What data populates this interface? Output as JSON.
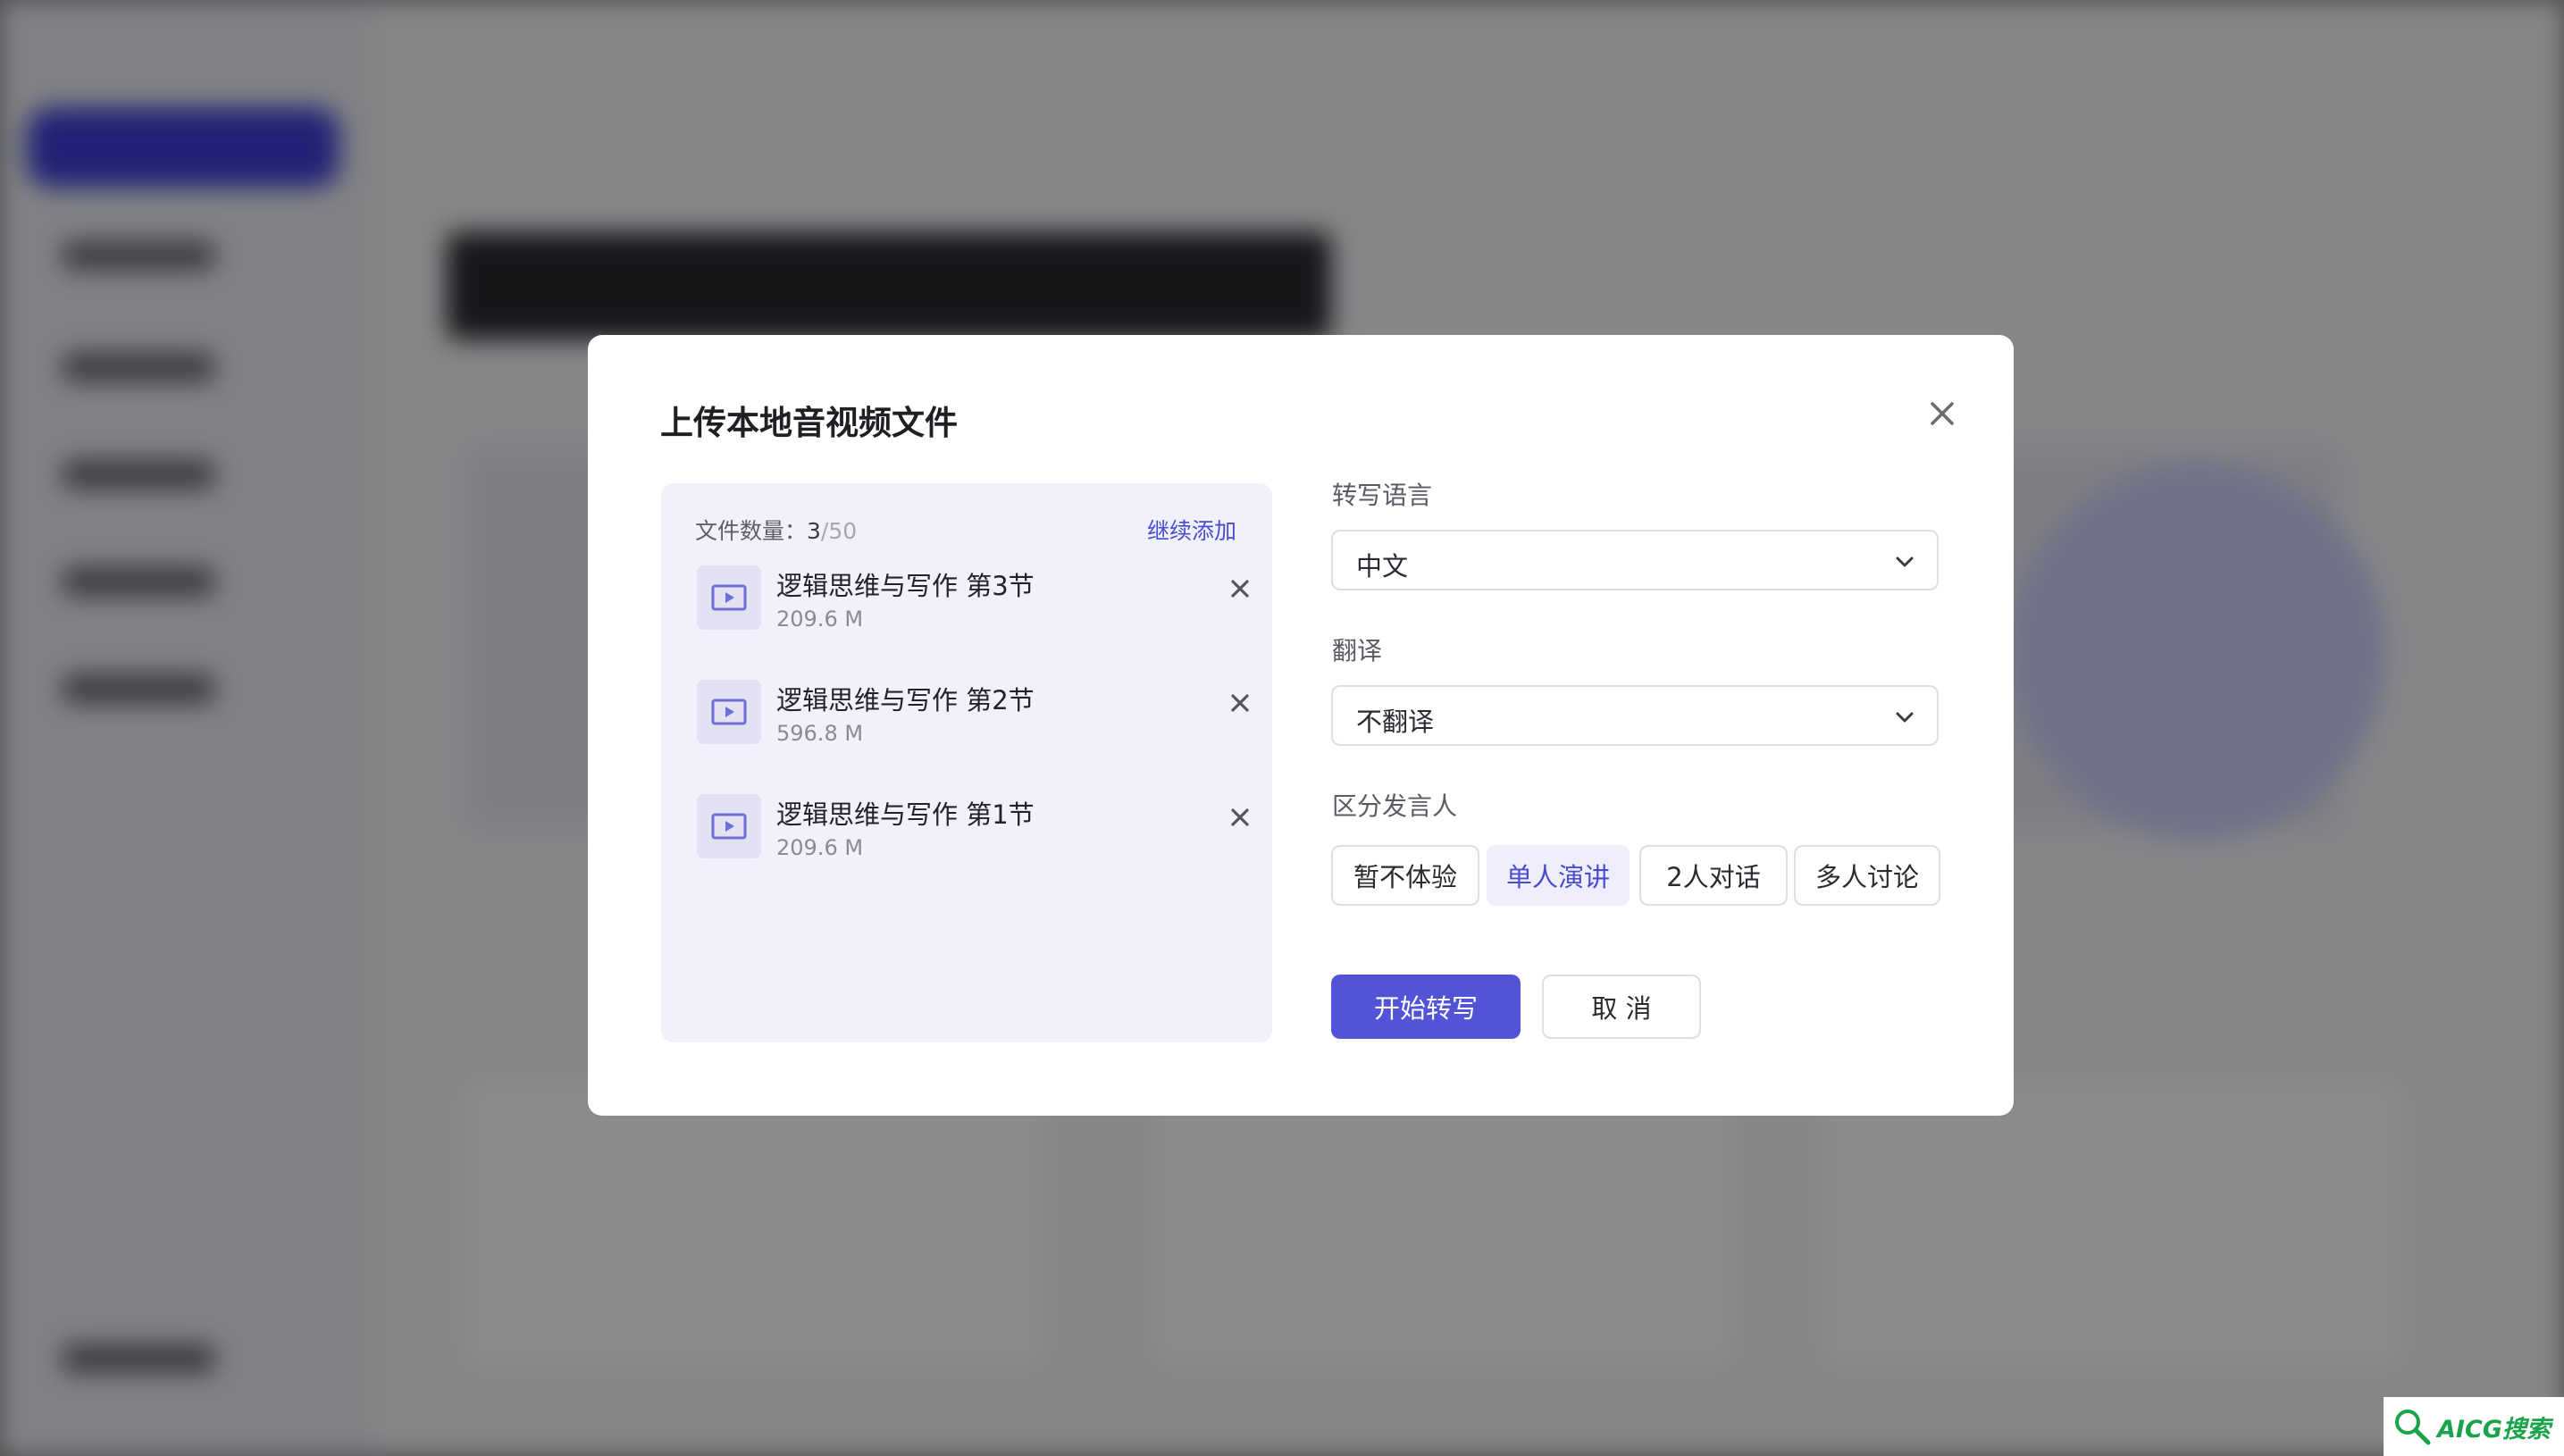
{
  "modal": {
    "title": "上传本地音视频文件",
    "file_panel": {
      "count_label": "文件数量：",
      "count_current": "3",
      "count_total": "/50",
      "add_more_label": "继续添加",
      "files": [
        {
          "name": "逻辑思维与写作 第3节",
          "size": "209.6 M"
        },
        {
          "name": "逻辑思维与写作 第2节",
          "size": "596.8 M"
        },
        {
          "name": "逻辑思维与写作 第1节",
          "size": "209.6 M"
        }
      ]
    },
    "transcribe_language": {
      "label": "转写语言",
      "value": "中文"
    },
    "translation": {
      "label": "翻译",
      "value": "不翻译"
    },
    "speaker_separation": {
      "label": "区分发言人",
      "options": [
        "暂不体验",
        "单人演讲",
        "2人对话",
        "多人讨论"
      ],
      "selected": "单人演讲"
    },
    "start_button": "开始转写",
    "cancel_button": "取 消"
  },
  "watermark": {
    "text": "AICG搜索"
  },
  "colors": {
    "accent": "#5353d8",
    "panel_bg": "#f1f1fb",
    "selected_bg": "#eeeefc"
  },
  "icons": [
    "close-icon",
    "video-file-icon",
    "chevron-down-icon",
    "search-icon"
  ]
}
